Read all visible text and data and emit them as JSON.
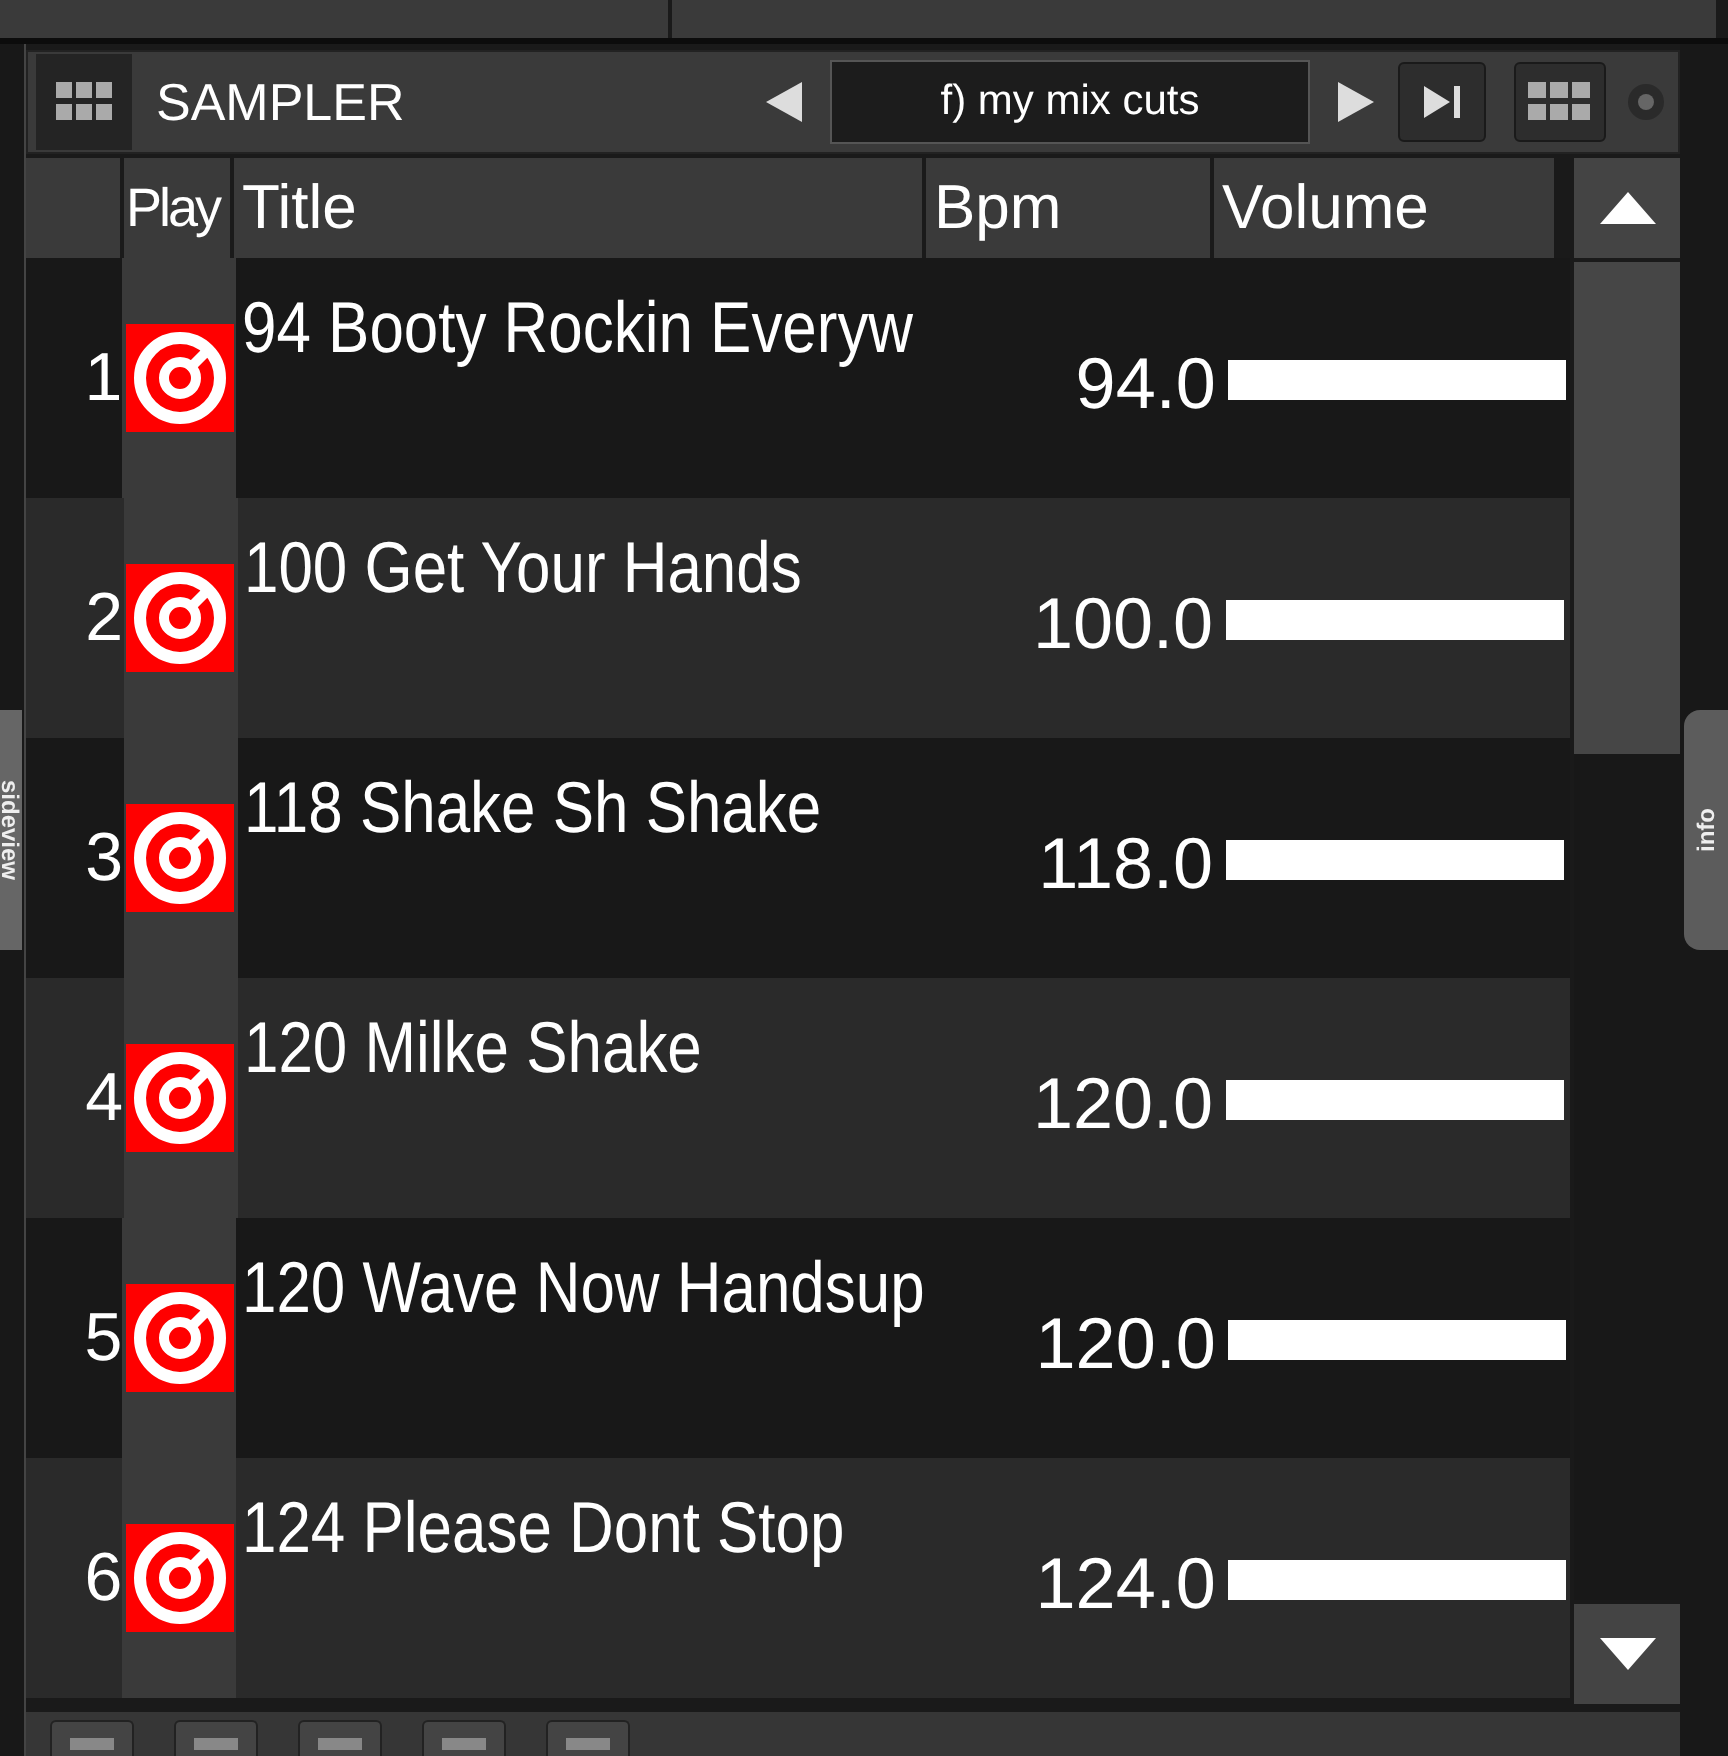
{
  "side_tabs": {
    "left": "sideview",
    "right": "info"
  },
  "sampler": {
    "title": "SAMPLER",
    "bank": "f) my mix cuts"
  },
  "columns": [
    "Play",
    "Title",
    "Bpm",
    "Volume"
  ],
  "rows": [
    {
      "number": "1",
      "title": "94 Booty Rockin Everyw",
      "bpm": "94.0",
      "level": 1
    },
    {
      "number": "2",
      "title": "100 Get Your Hands",
      "bpm": "100.0",
      "level": 1
    },
    {
      "number": "3",
      "title": "118 Shake Sh Shake",
      "bpm": "118.0",
      "level": 1
    },
    {
      "number": "4",
      "title": "120 Milke Shake",
      "bpm": "120.0",
      "level": 1
    },
    {
      "number": "5",
      "title": "120 Wave Now Handsup",
      "bpm": "120.0",
      "level": 1
    },
    {
      "number": "6",
      "title": "124 Please Dont Stop",
      "bpm": "124.0",
      "level": 1
    }
  ]
}
